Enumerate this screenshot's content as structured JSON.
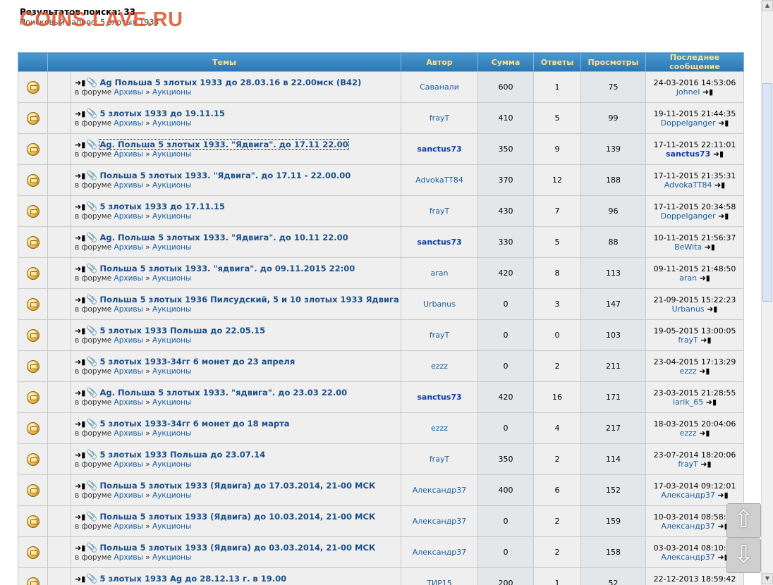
{
  "results": {
    "count_label": "Результатов поиска: 33",
    "query_label": "Поисковый запрос: 5 злотых 1933"
  },
  "watermark": "COINS.LAVE.RU",
  "columns": [
    "Темы",
    "Автор",
    "Сумма",
    "Ответы",
    "Просмотры",
    "Последнее сообщение"
  ],
  "forum_prefix": "в форуме",
  "forum_parent": "Архивы",
  "forum_sep": "»",
  "forum_child": "Аукционы",
  "rows": [
    {
      "title": "Ag Польша 5 злотых 1933 до 28.03.16 в 22.00мск (В42)",
      "author": "Саванали",
      "sum": "600",
      "replies": "1",
      "views": "75",
      "last_date": "24-03-2016 14:53:06",
      "last_user": "johnel"
    },
    {
      "title": "5 злотых 1933 до 19.11.15",
      "author": "frayT",
      "sum": "410",
      "replies": "5",
      "views": "99",
      "last_date": "19-11-2015 21:44:35",
      "last_user": "Doppelganger"
    },
    {
      "title": "Ag. Польша 5 злотых 1933. \"Ядвига\". до 17.11 22.00",
      "author": "sanctus73",
      "sum": "350",
      "replies": "9",
      "views": "139",
      "last_date": "17-11-2015 22:11:01",
      "last_user": "sanctus73"
    },
    {
      "title": "Польша 5 злотых 1933. \"Ядвига\". до 17.11 - 22.00.00",
      "author": "AdvokaTT84",
      "sum": "370",
      "replies": "12",
      "views": "188",
      "last_date": "17-11-2015 21:35:31",
      "last_user": "AdvokaTT84"
    },
    {
      "title": "5 злотых 1933 до 17.11.15",
      "author": "frayT",
      "sum": "430",
      "replies": "7",
      "views": "96",
      "last_date": "17-11-2015 20:34:58",
      "last_user": "Doppelganger"
    },
    {
      "title": "Ag. Польша 5 злотых 1933. \"Ядвига\". до 10.11 22.00",
      "author": "sanctus73",
      "sum": "330",
      "replies": "5",
      "views": "88",
      "last_date": "10-11-2015 21:56:37",
      "last_user": "BeWita"
    },
    {
      "title": "Польша 5 злотых 1933. \"ядвига\". до 09.11.2015 22:00",
      "author": "aran",
      "sum": "420",
      "replies": "8",
      "views": "113",
      "last_date": "09-11-2015 21:48:50",
      "last_user": "aran"
    },
    {
      "title": "Польша 5 злотых 1936 Пилсудский, 5 и 10 злотых 1933 Ядвига",
      "author": "Urbanus",
      "sum": "0",
      "replies": "3",
      "views": "147",
      "last_date": "21-09-2015 15:22:23",
      "last_user": "Urbanus"
    },
    {
      "title": "5 злотых 1933 Польша до 22.05.15",
      "author": "frayT",
      "sum": "0",
      "replies": "0",
      "views": "103",
      "last_date": "19-05-2015 13:00:05",
      "last_user": "frayT"
    },
    {
      "title": "5 злотых 1933-34гг 6 монет до 23 апреля",
      "author": "ezzz",
      "sum": "0",
      "replies": "2",
      "views": "211",
      "last_date": "23-04-2015 17:13:29",
      "last_user": "ezzz"
    },
    {
      "title": "Ag. Польша 5 злотых 1933. \"ядвига\". до 23.03 22.00",
      "author": "sanctus73",
      "sum": "420",
      "replies": "16",
      "views": "171",
      "last_date": "23-03-2015 21:28:55",
      "last_user": "larik_65"
    },
    {
      "title": "5 злотых 1933-34гг 6 монет до 18 марта",
      "author": "ezzz",
      "sum": "0",
      "replies": "4",
      "views": "217",
      "last_date": "18-03-2015 20:04:06",
      "last_user": "ezzz"
    },
    {
      "title": "5 злотых 1933 Польша до 23.07.14",
      "author": "frayT",
      "sum": "350",
      "replies": "2",
      "views": "114",
      "last_date": "23-07-2014 18:20:06",
      "last_user": "frayT"
    },
    {
      "title": "Польша 5 злотых 1933 (Ядвига) до 17.03.2014, 21-00 МСК",
      "author": "Александр37",
      "sum": "400",
      "replies": "6",
      "views": "152",
      "last_date": "17-03-2014 09:12:01",
      "last_user": "Александр37"
    },
    {
      "title": "Польша 5 злотых 1933 (Ядвига) до 10.03.2014, 21-00 МСК",
      "author": "Александр37",
      "sum": "0",
      "replies": "2",
      "views": "159",
      "last_date": "10-03-2014 08:58:25",
      "last_user": "Александр37"
    },
    {
      "title": "Польша 5 злотых 1933 (Ядвига) до 03.03.2014, 21-00 МСК",
      "author": "Александр37",
      "sum": "0",
      "replies": "2",
      "views": "158",
      "last_date": "03-03-2014 08:10:14",
      "last_user": "Александр37"
    },
    {
      "title": "5 злотых 1933 Ag до 28.12.13 г. в 19.00",
      "author": "ТИР15",
      "sum": "200",
      "replies": "1",
      "views": "52",
      "last_date": "22-12-2013 18:59:42",
      "last_user": ""
    }
  ]
}
